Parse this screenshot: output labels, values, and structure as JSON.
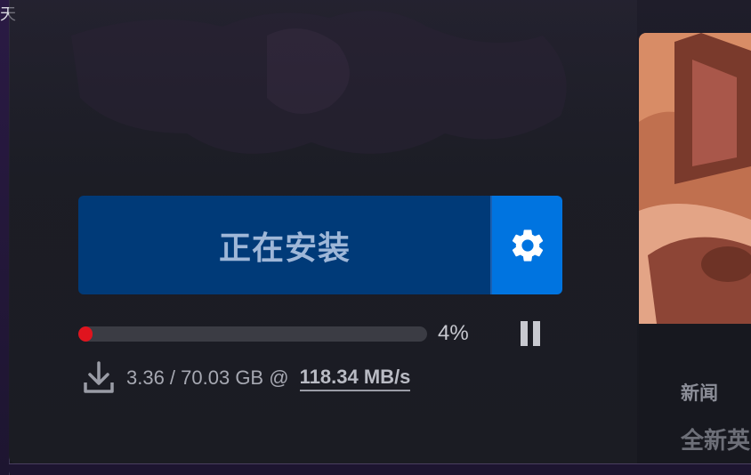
{
  "edge": {
    "char": "天"
  },
  "install": {
    "label": "正在安装",
    "settings_icon": "gear-icon"
  },
  "progress": {
    "percent_value": 4,
    "percent_label": "4%",
    "bar_color": "#e0141e",
    "pause_icon": "pause-icon"
  },
  "download": {
    "icon": "download-icon",
    "size_text": "3.36 / 70.03 GB @ ",
    "speed": "118.34 MB/s"
  },
  "news": {
    "label": "新闻",
    "title": "全新英"
  },
  "colors": {
    "install_button": "#003a78",
    "settings_button": "#0074e0",
    "background": "#1b1c23"
  }
}
